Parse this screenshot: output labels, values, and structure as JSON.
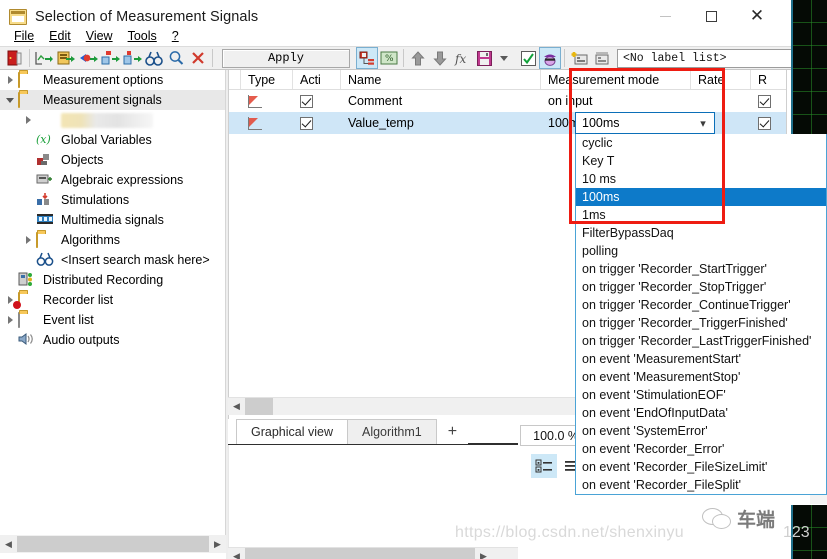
{
  "window": {
    "title": "Selection of Measurement Signals",
    "icon": "window-app-icon",
    "minimize": "–",
    "maximize": "□",
    "close": "✕"
  },
  "menu": {
    "items": [
      {
        "label": "File",
        "accel": "F"
      },
      {
        "label": "Edit",
        "accel": "E"
      },
      {
        "label": "View",
        "accel": "V"
      },
      {
        "label": "Tools",
        "accel": "T"
      },
      {
        "label": "?",
        "accel": "?"
      }
    ]
  },
  "toolbar": {
    "apply_label": "Apply",
    "label_list_value": "<No label list>",
    "buttons": [
      {
        "name": "exit-door-icon"
      },
      {
        "name": "import-signals-icon"
      },
      {
        "name": "export-signals-icon"
      },
      {
        "name": "add-signal-icon"
      },
      {
        "name": "copy-signal-icon"
      },
      {
        "name": "paste-signal-icon"
      },
      {
        "name": "binoculars-search-icon"
      },
      {
        "name": "magnifier-icon"
      },
      {
        "name": "delete-x-icon"
      },
      {
        "name": "structure-view-icon"
      },
      {
        "name": "percent-table-icon"
      },
      {
        "name": "move-up-icon"
      },
      {
        "name": "move-down-icon"
      },
      {
        "name": "function-fx-icon"
      },
      {
        "name": "save-icon"
      },
      {
        "name": "save-dropdown-icon"
      },
      {
        "name": "check-green-icon"
      },
      {
        "name": "mask-user-icon"
      },
      {
        "name": "add-label-icon"
      },
      {
        "name": "edit-label-icon"
      }
    ]
  },
  "tree": {
    "items": [
      {
        "label": "Measurement options",
        "icon": "folder-icon",
        "indent": 0,
        "twisty": "collapsed",
        "selected": false
      },
      {
        "label": "Measurement signals",
        "icon": "folder-open-icon",
        "indent": 0,
        "twisty": "expanded",
        "selected": true
      },
      {
        "label": "",
        "icon": "blurred-icon",
        "indent": 1,
        "twisty": "collapsed",
        "selected": false,
        "blurred": true
      },
      {
        "label": "Global Variables",
        "icon": "variable-x-icon",
        "indent": 2,
        "twisty": "none",
        "selected": false
      },
      {
        "label": "Objects",
        "icon": "objects-icon",
        "indent": 2,
        "twisty": "none",
        "selected": false
      },
      {
        "label": "Algebraic expressions",
        "icon": "algebraic-expression-icon",
        "indent": 2,
        "twisty": "none",
        "selected": false
      },
      {
        "label": "Stimulations",
        "icon": "stimulations-icon",
        "indent": 2,
        "twisty": "none",
        "selected": false
      },
      {
        "label": "Multimedia signals",
        "icon": "multimedia-film-icon",
        "indent": 2,
        "twisty": "none",
        "selected": false
      },
      {
        "label": "Algorithms",
        "icon": "folder-icon",
        "indent": 1,
        "twisty": "collapsed",
        "selected": false
      },
      {
        "label": "<Insert search mask here>",
        "icon": "binoculars-icon",
        "indent": 2,
        "twisty": "none",
        "selected": false
      },
      {
        "label": "Distributed Recording",
        "icon": "distributed-recording-icon",
        "indent": 0,
        "twisty": "none",
        "selected": false
      },
      {
        "label": "Recorder list",
        "icon": "folder-record-icon",
        "indent": 0,
        "twisty": "collapsed",
        "selected": false
      },
      {
        "label": "Event list",
        "icon": "folder-event-icon",
        "indent": 0,
        "twisty": "collapsed",
        "selected": false
      },
      {
        "label": "Audio outputs",
        "icon": "audio-output-icon",
        "indent": 0,
        "twisty": "none",
        "selected": false
      }
    ]
  },
  "grid": {
    "columns": [
      "Type",
      "Acti",
      "Name",
      "Measurement mode",
      "Rate",
      "R"
    ],
    "rows": [
      {
        "type_icon": "signal-type-icon",
        "active": true,
        "name": "Comment",
        "mode": "on input",
        "rate": "",
        "r": true,
        "selected": false
      },
      {
        "type_icon": "signal-type-icon",
        "active": true,
        "name": "Value_temp",
        "mode": "100ms",
        "rate": "",
        "r": true,
        "selected": true
      }
    ]
  },
  "combo": {
    "value": "100ms",
    "open": true,
    "options": [
      {
        "label": "cyclic",
        "highlighted": false
      },
      {
        "label": "Key T",
        "highlighted": false
      },
      {
        "label": "10 ms",
        "highlighted": false
      },
      {
        "label": "100ms",
        "highlighted": true
      },
      {
        "label": "1ms",
        "highlighted": false
      },
      {
        "label": "FilterBypassDaq",
        "highlighted": false
      },
      {
        "label": "polling",
        "highlighted": false
      },
      {
        "label": "on trigger 'Recorder_StartTrigger'",
        "highlighted": false
      },
      {
        "label": "on trigger 'Recorder_StopTrigger'",
        "highlighted": false
      },
      {
        "label": "on trigger 'Recorder_ContinueTrigger'",
        "highlighted": false
      },
      {
        "label": "on trigger 'Recorder_TriggerFinished'",
        "highlighted": false
      },
      {
        "label": "on trigger 'Recorder_LastTriggerFinished'",
        "highlighted": false
      },
      {
        "label": "on event 'MeasurementStart'",
        "highlighted": false
      },
      {
        "label": "on event 'MeasurementStop'",
        "highlighted": false
      },
      {
        "label": "on event 'StimulationEOF'",
        "highlighted": false
      },
      {
        "label": "on event 'EndOfInputData'",
        "highlighted": false
      },
      {
        "label": "on event 'SystemError'",
        "highlighted": false
      },
      {
        "label": "on event 'Recorder_Error'",
        "highlighted": false
      },
      {
        "label": "on event 'Recorder_FileSizeLimit'",
        "highlighted": false
      },
      {
        "label": "on event 'Recorder_FileSplit'",
        "highlighted": false
      }
    ]
  },
  "bottom": {
    "tabs": [
      {
        "label": "Graphical view",
        "active": true
      },
      {
        "label": "Algorithm1",
        "active": false
      }
    ],
    "add_tab_label": "+",
    "zoom_value": "100.0 %",
    "view_buttons": [
      {
        "name": "detail-view-icon",
        "active": true
      },
      {
        "name": "list-view-icon",
        "active": false
      }
    ]
  },
  "watermark": {
    "url": "https://blog.csdn.net/shenxinyu123",
    "url_visible": "https://blog.csdn.net/shenxinyu",
    "number": "123",
    "brand": "车端",
    "brand_icon": "wechat-icon"
  },
  "colors": {
    "accent_blue": "#0d7ac9",
    "selection_row": "#cfe6f7",
    "annotation_red": "#ee1c12",
    "toolbar_bg": "#f0f0f0",
    "tree_selected": "#e8e8e8"
  }
}
